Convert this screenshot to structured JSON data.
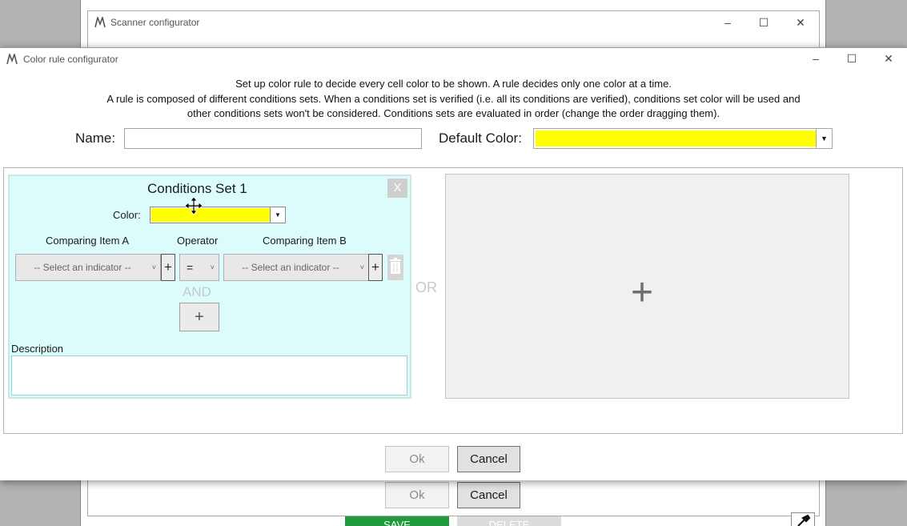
{
  "background_window": {
    "title": "Scanner configurator",
    "ok_label": "Ok",
    "cancel_label": "Cancel",
    "save_label": "SAVE",
    "delete_label": "DELETE"
  },
  "dialog": {
    "title": "Color rule configurator",
    "instructions": [
      "Set up color rule to decide every cell color to be shown. A rule decides only one color at a time.",
      "A rule is composed of different conditions sets. When a conditions set is verified (i.e. all its conditions are verified), conditions set color will be used and",
      "other conditions sets won't be considered. Conditions sets are evaluated in order (change the order dragging them)."
    ],
    "name_label": "Name:",
    "name_value": "",
    "default_color_label": "Default Color:",
    "default_color": "#ffff00",
    "or_label": "OR",
    "ok_label": "Ok",
    "cancel_label": "Cancel"
  },
  "conditions_sets": [
    {
      "title": "Conditions Set 1",
      "close_label": "X",
      "color_label": "Color:",
      "color": "#ffff00",
      "headers": {
        "item_a": "Comparing Item A",
        "operator": "Operator",
        "item_b": "Comparing Item B"
      },
      "condition": {
        "item_a_placeholder": "-- Select an indicator --",
        "operator": "=",
        "item_b_placeholder": "-- Select an indicator --"
      },
      "and_label": "AND",
      "add_condition_label": "+",
      "description_label": "Description",
      "description_value": ""
    }
  ],
  "add_set_label": "+",
  "icons": {
    "app": "app-logo-icon",
    "minimize": "minimize-icon",
    "maximize": "maximize-icon",
    "close": "close-icon",
    "delete": "trash-icon",
    "cursor": "move-cursor-icon"
  }
}
